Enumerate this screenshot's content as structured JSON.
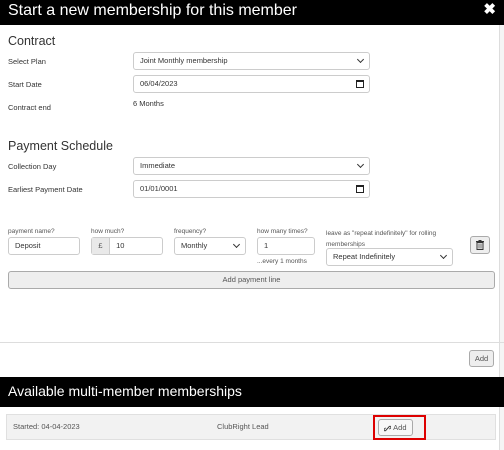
{
  "header": {
    "title": "Start a new membership for this member",
    "close_label": "✖"
  },
  "contract": {
    "section_title": "Contract",
    "plan_label": "Select Plan",
    "plan_value": "Joint Monthly membership",
    "start_label": "Start Date",
    "start_value": "06/04/2023",
    "end_label": "Contract end",
    "end_value": "6 Months"
  },
  "payment_schedule": {
    "section_title": "Payment Schedule",
    "collection_label": "Collection Day",
    "collection_value": "Immediate",
    "earliest_label": "Earliest Payment Date",
    "earliest_value": "01/01/0001"
  },
  "payment_line": {
    "name_label": "payment name?",
    "name_value": "Deposit",
    "amount_label": "how much?",
    "currency": "£",
    "amount_value": "10",
    "frequency_label": "frequency?",
    "frequency_value": "Monthly",
    "times_label": "how many times?",
    "times_value": "1",
    "times_help": "...every 1 months",
    "repeat_label": "leave as \"repeat indefinitely\" for rolling memberships",
    "repeat_value": "Repeat Indefinitely",
    "add_line_label": "Add payment line"
  },
  "footer": {
    "add_label": "Add"
  },
  "available": {
    "title": "Available multi-member memberships",
    "rows": [
      {
        "started": "Started: 04-04-2023",
        "lead": "ClubRight Lead",
        "add_label": "Add"
      }
    ]
  }
}
